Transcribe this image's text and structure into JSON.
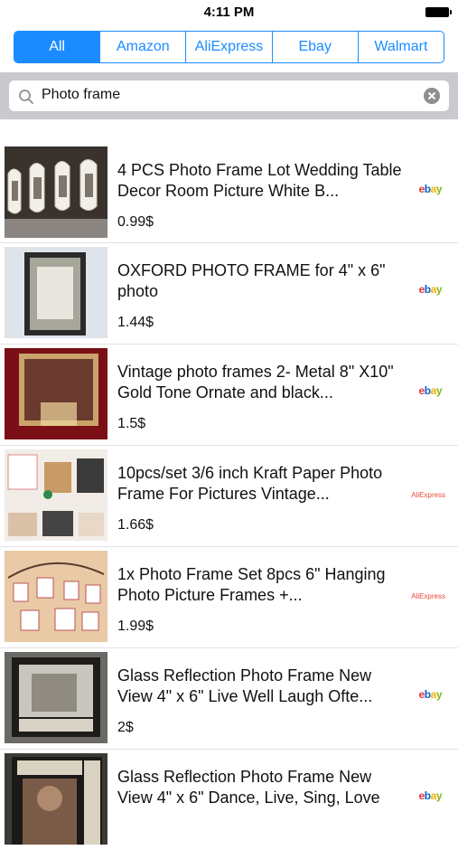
{
  "status_bar": {
    "time": "4:11 PM"
  },
  "segments": [
    {
      "label": "All",
      "active": true
    },
    {
      "label": "Amazon",
      "active": false
    },
    {
      "label": "AliExpress",
      "active": false
    },
    {
      "label": "Ebay",
      "active": false
    },
    {
      "label": "Walmart",
      "active": false
    }
  ],
  "search": {
    "value": "Photo frame"
  },
  "colors": {
    "accent": "#1a8cff",
    "search_bar_bg": "#c9c9ce"
  },
  "results": [
    {
      "title": "4 PCS Photo Frame Lot Wedding Table Decor Room Picture White B...",
      "price": "0.99$",
      "store": "ebay",
      "thumb_icon": "white-ornate-frames-image"
    },
    {
      "title": "OXFORD PHOTO FRAME for 4\" x 6\" photo",
      "price": "1.44$",
      "store": "ebay",
      "thumb_icon": "black-frame-image"
    },
    {
      "title": "Vintage photo frames 2- Metal 8\" X10\" Gold Tone Ornate and black...",
      "price": "1.5$",
      "store": "ebay",
      "thumb_icon": "gold-frame-image"
    },
    {
      "title": "10pcs/set 3/6 inch Kraft Paper Photo Frame For Pictures Vintage...",
      "price": "1.66$",
      "store": "AliExpress",
      "thumb_icon": "kraft-paper-frames-image"
    },
    {
      "title": "1x Photo Frame Set 8pcs 6\" Hanging Photo Picture Frames +...",
      "price": "1.99$",
      "store": "AliExpress",
      "thumb_icon": "hanging-frames-image"
    },
    {
      "title": "Glass Reflection Photo Frame New View 4\" x 6\" Live Well Laugh Ofte...",
      "price": "2$",
      "store": "ebay",
      "thumb_icon": "live-laugh-frame-image"
    },
    {
      "title": "Glass Reflection Photo Frame New View 4\" x 6\" Dance, Live, Sing, Love",
      "price": "",
      "store": "ebay",
      "thumb_icon": "dance-frame-image"
    }
  ]
}
